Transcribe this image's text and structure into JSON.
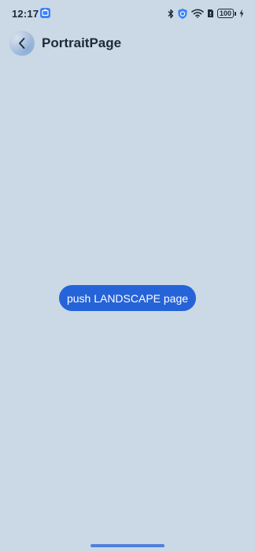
{
  "status_bar": {
    "time": "12:17",
    "notification_icon": "app-notification-icon",
    "icons": [
      "bluetooth-icon",
      "shield-icon",
      "wifi-icon",
      "sim-icon"
    ],
    "battery": "100",
    "charging_icon": "bolt-icon"
  },
  "header": {
    "back_icon": "chevron-left-icon",
    "title": "PortraitPage"
  },
  "main": {
    "push_button_label": "push LANDSCAPE page"
  },
  "colors": {
    "background": "#cbd8e6",
    "accent": "#2563d8",
    "text": "#1f2937"
  }
}
